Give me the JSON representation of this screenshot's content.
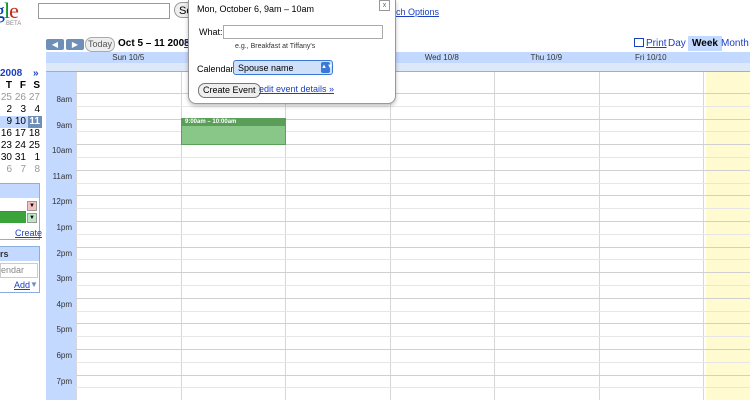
{
  "logo": {
    "text_parts": [
      "g",
      "l",
      "e"
    ],
    "beta": "BETA"
  },
  "search": {
    "button_label": "Se",
    "options_link": "rch Options"
  },
  "nav": {
    "today": "Today",
    "date_range": "Oct 5 – 11 2008",
    "next_partial": "F",
    "print": "Print",
    "views": {
      "day": "Day",
      "week": "Week",
      "month": "Month"
    }
  },
  "mini_calendar": {
    "header": "2008",
    "next": "»",
    "dow": [
      "T",
      "F",
      "S"
    ],
    "rows": [
      {
        "days": [
          "25",
          "26",
          "27"
        ],
        "muted": true
      },
      {
        "days": [
          "2",
          "3",
          "4"
        ]
      },
      {
        "days": [
          "9",
          "10",
          "11"
        ],
        "current_week": true,
        "selected": "11"
      },
      {
        "days": [
          "16",
          "17",
          "18"
        ]
      },
      {
        "days": [
          "23",
          "24",
          "25"
        ]
      },
      {
        "days": [
          "30",
          "31",
          "1"
        ]
      },
      {
        "days": [
          "6",
          "7",
          "8"
        ],
        "muted": true
      }
    ]
  },
  "left_panels": {
    "create_link": "Create",
    "other_placeholder": "endar",
    "other_title": "rs",
    "add_link": "Add"
  },
  "grid": {
    "day_headers": [
      {
        "label": "Sun 10/5",
        "col": 0
      },
      {
        "label": "Wed 10/8",
        "col": 3
      },
      {
        "label": "Thu 10/9",
        "col": 4
      },
      {
        "label": "Fri 10/10",
        "col": 5
      }
    ],
    "hours": [
      "8am",
      "9am",
      "10am",
      "11am",
      "12pm",
      "1pm",
      "2pm",
      "3pm",
      "4pm",
      "5pm",
      "6pm",
      "7pm"
    ]
  },
  "event": {
    "time": "9:00am – 10:00am",
    "color": "#88c788"
  },
  "popup": {
    "title": "Mon, October 6, 9am – 10am",
    "close": "x",
    "what_label": "What:",
    "what_value": "",
    "example": "e.g., Breakfast at Tiffany's",
    "calendar_label": "Calendar:",
    "calendar_value": "Spouse name",
    "create_button": "Create Event",
    "details_link": "edit event details »"
  },
  "colors": {
    "accent": "#c3d9ff",
    "link": "#1a3fbf",
    "today_column": "#fffad0"
  }
}
